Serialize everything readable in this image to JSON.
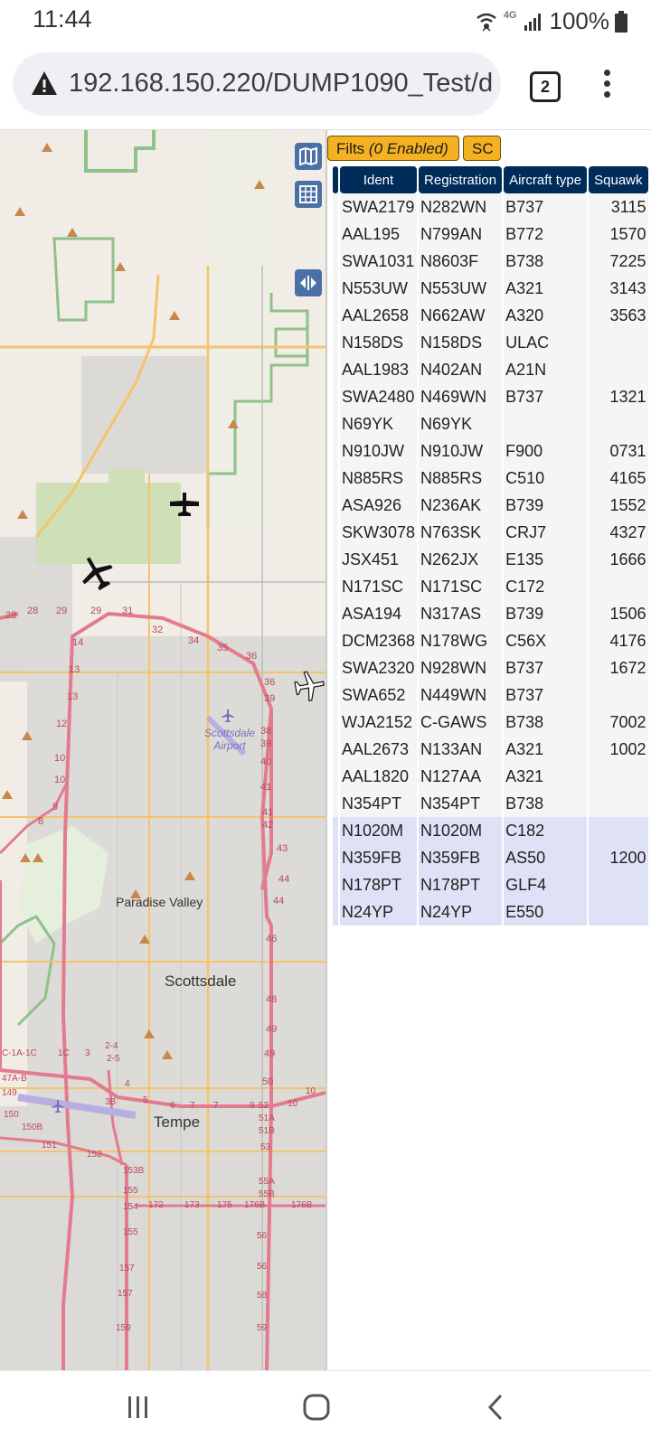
{
  "status": {
    "time": "11:44",
    "battery": "100%",
    "network": "4G"
  },
  "browser": {
    "url": "192.168.150.220/DUMP1090_Test/d",
    "tab_count": "2"
  },
  "map": {
    "labels": {
      "scottsdale_airport": "Scottsdale Airport",
      "paradise_valley": "Paradise Valley",
      "scottsdale": "Scottsdale",
      "tempe": "Tempe"
    }
  },
  "panel": {
    "filters_label": "Filts",
    "filters_status": "(0 Enabled)",
    "sc_label": "SC",
    "columns": [
      "Ident",
      "Registration",
      "Aircraft type",
      "Squawk"
    ],
    "rows": [
      [
        "SWA2179",
        "N282WN",
        "B737",
        "3115"
      ],
      [
        "AAL195",
        "N799AN",
        "B772",
        "1570"
      ],
      [
        "SWA1031",
        "N8603F",
        "B738",
        "7225"
      ],
      [
        "N553UW",
        "N553UW",
        "A321",
        "3143"
      ],
      [
        "AAL2658",
        "N662AW",
        "A320",
        "3563"
      ],
      [
        "N158DS",
        "N158DS",
        "ULAC",
        ""
      ],
      [
        "AAL1983",
        "N402AN",
        "A21N",
        ""
      ],
      [
        "SWA2480",
        "N469WN",
        "B737",
        "1321"
      ],
      [
        "N69YK",
        "N69YK",
        "",
        ""
      ],
      [
        "N910JW",
        "N910JW",
        "F900",
        "0731"
      ],
      [
        "N885RS",
        "N885RS",
        "C510",
        "4165"
      ],
      [
        "ASA926",
        "N236AK",
        "B739",
        "1552"
      ],
      [
        "SKW3078",
        "N763SK",
        "CRJ7",
        "4327"
      ],
      [
        "JSX451",
        "N262JX",
        "E135",
        "1666"
      ],
      [
        "N171SC",
        "N171SC",
        "C172",
        ""
      ],
      [
        "ASA194",
        "N317AS",
        "B739",
        "1506"
      ],
      [
        "DCM2368",
        "N178WG",
        "C56X",
        "4176"
      ],
      [
        "SWA2320",
        "N928WN",
        "B737",
        "1672"
      ],
      [
        "SWA652",
        "N449WN",
        "B737",
        ""
      ],
      [
        "WJA2152",
        "C-GAWS",
        "B738",
        "7002"
      ],
      [
        "AAL2673",
        "N133AN",
        "A321",
        "1002"
      ],
      [
        "AAL1820",
        "N127AA",
        "A321",
        ""
      ],
      [
        "N354PT",
        "N354PT",
        "B738",
        ""
      ],
      [
        "N1020M",
        "N1020M",
        "C182",
        ""
      ],
      [
        "N359FB",
        "N359FB",
        "AS50",
        "1200"
      ],
      [
        "N178PT",
        "N178PT",
        "GLF4",
        ""
      ],
      [
        "N24YP",
        "N24YP",
        "E550",
        ""
      ]
    ],
    "selected_from": 23
  },
  "colors": {
    "header_bg": "#002c5a",
    "button_yellow": "#f4b223",
    "map_button": "#2d5b9c",
    "selected_row": "#dfe1f7"
  }
}
